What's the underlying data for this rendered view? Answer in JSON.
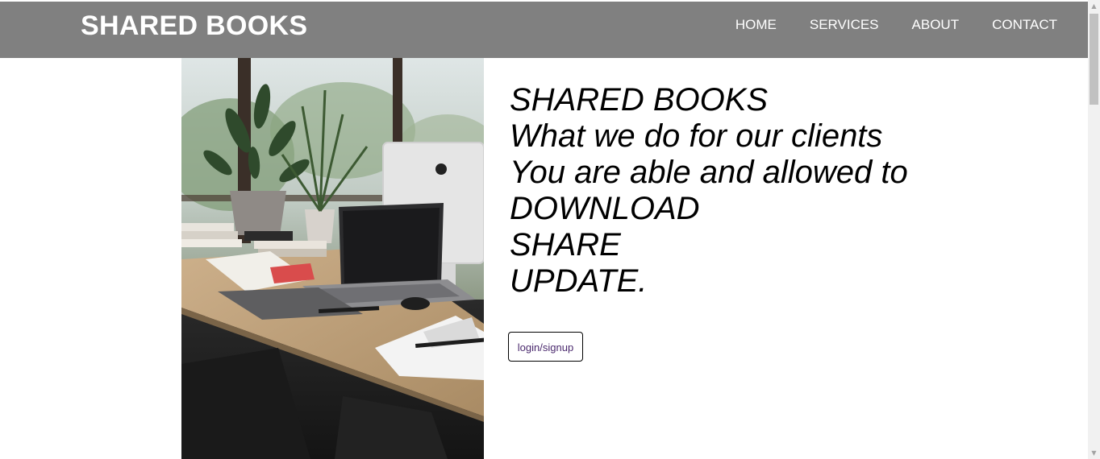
{
  "header": {
    "brand": "SHARED BOOKS",
    "nav": [
      {
        "label": "HOME"
      },
      {
        "label": "SERVICES"
      },
      {
        "label": "ABOUT"
      },
      {
        "label": "CONTACT"
      }
    ]
  },
  "hero": {
    "lines": [
      "SHARED BOOKS",
      "What we do for our clients",
      "You are able and allowed to",
      "DOWNLOAD",
      "SHARE",
      "UPDATE."
    ],
    "cta_label": "login/signup",
    "image_description_icon": "desk-photo"
  },
  "scrollbar": {
    "up_icon": "scroll-up-icon",
    "down_icon": "scroll-down-icon"
  },
  "colors": {
    "header_bg": "#808080",
    "header_text": "#ffffff",
    "cta_text": "#4b2a6e"
  }
}
